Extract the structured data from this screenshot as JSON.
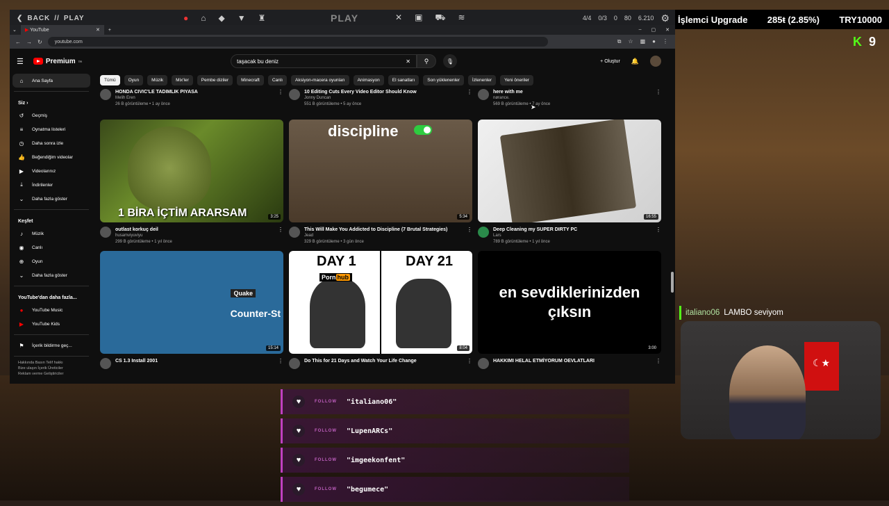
{
  "overlay": {
    "back": "BACK",
    "sep": "//",
    "play_label": "PLAY",
    "title": "PLAY",
    "stats": {
      "s1": "4/4",
      "s2": "0/3",
      "s3": "0",
      "s4": "80",
      "s5": "6.210"
    },
    "banner": "İşlemci Upgrade",
    "banner_amount": "285ŧ (2.85%)",
    "banner_goal": "TRY10000",
    "k_letter": "K",
    "k_num": "9"
  },
  "browser": {
    "tab_title": "YouTube",
    "url": "youtube.com"
  },
  "youtube": {
    "logo": "Premium",
    "logo_sup": "TR",
    "search_value": "taşacak bu deniz",
    "create": "Oluştur",
    "sidebar": {
      "home": "Ana Sayfa",
      "you": "Siz",
      "you_items": [
        "Geçmiş",
        "Oynatma listeleri",
        "Daha sonra izle",
        "Beğendiğim videolar",
        "Videolarınız",
        "İndirilenler",
        "Daha fazla göster"
      ],
      "explore": "Keşfet",
      "explore_items": [
        "Müzik",
        "Canlı",
        "Oyun",
        "Daha fazla göster"
      ],
      "more_yt": "YouTube'dan daha fazla...",
      "more_items": [
        "YouTube Music",
        "YouTube Kids"
      ],
      "feedback": "İçerik bildirme geç...",
      "footer1": "Hakkında  Basın  Telif hakkı",
      "footer2": "Bize ulaşın  İçerik Üreticiler",
      "footer3": "Reklam verme  Geliştiriciler"
    },
    "chips": [
      "Tümü",
      "Oyun",
      "Müzik",
      "Mix'ler",
      "Pembe diziler",
      "Minecraft",
      "Canlı",
      "Aksiyon-macera oyunları",
      "Animasyon",
      "El sanatları",
      "Son yüklenenler",
      "İzlenenler",
      "Yeni öneriler"
    ],
    "top_row": [
      {
        "title": "HONDA CIVIC'LE TADIMLIK PIYASA",
        "channel": "Melih Eren",
        "stats": "26 B görüntüleme • 1 ay önce"
      },
      {
        "title": "10 Editing Cuts Every Video Editor Should Know",
        "channel": "Jonny Duncan",
        "stats": "551 B görüntüleme • 5 ay önce"
      },
      {
        "title": "here with me",
        "channel": "nørance.",
        "stats": "569 B görüntüleme • 7 ay önce"
      }
    ],
    "row1": [
      {
        "title": "outlast korkuç deil",
        "channel": "husamviyuviyu",
        "stats": "299 B görüntüleme • 1 yıl önce",
        "duration": "3:25",
        "caption": "1 BİRA İÇTİM ARARSAM"
      },
      {
        "title": "This Will Make You Addicted to Discipline (7 Brutal Strategies)",
        "channel": "Jead",
        "stats": "329 B görüntüleme • 3 gün önce",
        "duration": "5:34",
        "caption": "discipline"
      },
      {
        "title": "Deep Cleaning my SUPER DIRTY PC",
        "channel": "Lars",
        "stats": "789 B görüntüleme • 1 yıl önce",
        "duration": "16:55"
      }
    ],
    "row2": [
      {
        "title": "CS 1.3 Install 2001",
        "duration": "15:14",
        "caption1": "Counter-St",
        "caption2": "Quake"
      },
      {
        "title": "Do This for 21 Days and Watch Your Life Change",
        "duration": "8:04",
        "day1": "DAY 1",
        "day21": "DAY 21",
        "ph1": "Porn",
        "ph2": "hub"
      },
      {
        "title": "HAKKIMI HELAL ETMİYORUM OEVLATLARI",
        "duration": "3:00",
        "caption": "en sevdiklerinizden çıksın"
      }
    ]
  },
  "chat": {
    "user": "italiano06",
    "message": "LAMBO seviyom"
  },
  "follows": {
    "label": "FOLLOW",
    "names": [
      "\"italiano06\"",
      "\"LupenARCs\"",
      "\"imgeekonfent\"",
      "\"begumece\""
    ]
  },
  "colors": {
    "kick_green": "#53fc18",
    "yt_red": "#ff0000",
    "follow_purple": "#c040c0"
  }
}
